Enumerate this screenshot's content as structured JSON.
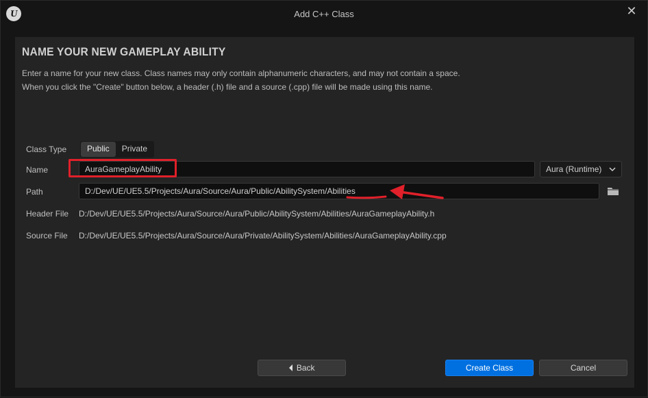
{
  "window": {
    "title": "Add C++ Class",
    "logo_text": "U",
    "close_glyph": "✕"
  },
  "header": {
    "heading": "NAME YOUR NEW GAMEPLAY ABILITY",
    "desc_line1": "Enter a name for your new class. Class names may only contain alphanumeric characters, and may not contain a space.",
    "desc_line2": "When you click the \"Create\" button below, a header (.h) file and a source (.cpp) file will be made using this name."
  },
  "form": {
    "class_type_label": "Class Type",
    "class_type_options": [
      "Public",
      "Private"
    ],
    "class_type_selected": "Public",
    "name_label": "Name",
    "name_value": "AuraGameplayAbility",
    "module_value": "Aura (Runtime)",
    "path_label": "Path",
    "path_value": "D:/Dev/UE/UE5.5/Projects/Aura/Source/Aura/Public/AbilitySystem/Abilities",
    "header_file_label": "Header File",
    "header_file_value": "D:/Dev/UE/UE5.5/Projects/Aura/Source/Aura/Public/AbilitySystem/Abilities/AuraGameplayAbility.h",
    "source_file_label": "Source File",
    "source_file_value": "D:/Dev/UE/UE5.5/Projects/Aura/Source/Aura/Private/AbilitySystem/Abilities/AuraGameplayAbility.cpp"
  },
  "buttons": {
    "back": "Back",
    "create": "Create Class",
    "cancel": "Cancel"
  },
  "icons": {
    "folder": "folder-icon",
    "chevron": "chevron-down-icon",
    "back_arrow": "chevron-left-icon"
  },
  "colors": {
    "accent": "#0070e0",
    "annotation": "#e0202a"
  }
}
